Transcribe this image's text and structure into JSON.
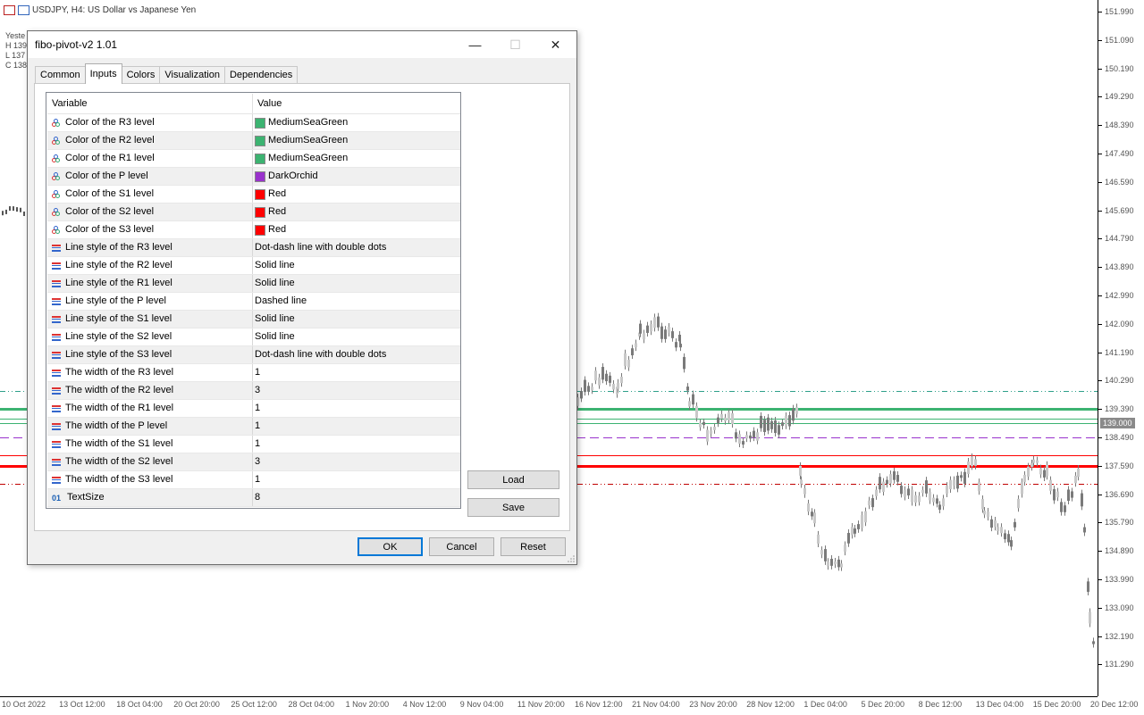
{
  "chart": {
    "symbol_line": "USDJPY, H4:  US Dollar vs Japanese Yen",
    "ohlc": [
      "Yeste",
      "H 139",
      "L 137",
      "C 138"
    ],
    "price_labels": [
      "151.990",
      "151.090",
      "150.190",
      "149.290",
      "148.390",
      "147.490",
      "146.590",
      "145.690",
      "144.790",
      "143.890",
      "142.990",
      "142.090",
      "141.190",
      "140.290",
      "139.390",
      "138.490",
      "137.590",
      "136.690",
      "135.790",
      "134.890",
      "133.990",
      "133.090",
      "132.190",
      "131.290"
    ],
    "current_price": "139.000",
    "time_labels": [
      "10 Oct 2022",
      "13 Oct 12:00",
      "18 Oct 04:00",
      "20 Oct 20:00",
      "25 Oct 12:00",
      "28 Oct 04:00",
      "1 Nov 20:00",
      "4 Nov 12:00",
      "9 Nov 04:00",
      "11 Nov 20:00",
      "16 Nov 12:00",
      "21 Nov 04:00",
      "23 Nov 20:00",
      "28 Nov 12:00",
      "1 Dec 04:00",
      "5 Dec 20:00",
      "8 Dec 12:00",
      "13 Dec 04:00",
      "15 Dec 20:00",
      "20 Dec 12:00"
    ],
    "colors": {
      "r3": "#2fa08a",
      "r2": "#3cb371",
      "r1": "#3cb371",
      "p": "#9932cc",
      "s1": "#ff0000",
      "s2": "#ff0000",
      "s3": "#c00000",
      "candles": "#7a7a7a"
    }
  },
  "dialog": {
    "title": "fibo-pivot-v2 1.01",
    "minimize_glyph": "—",
    "maximize_glyph": "☐",
    "close_glyph": "✕",
    "tabs": [
      "Common",
      "Inputs",
      "Colors",
      "Visualization",
      "Dependencies"
    ],
    "active_tab": "Inputs",
    "grid": {
      "col_variable": "Variable",
      "col_value": "Value",
      "rows": [
        {
          "icon": "color",
          "variable": "Color of the R3 level",
          "value": "MediumSeaGreen",
          "swatch": "#3cb371"
        },
        {
          "icon": "color",
          "variable": "Color of the R2 level",
          "value": "MediumSeaGreen",
          "swatch": "#3cb371"
        },
        {
          "icon": "color",
          "variable": "Color of the R1 level",
          "value": "MediumSeaGreen",
          "swatch": "#3cb371"
        },
        {
          "icon": "color",
          "variable": "Color of the P level",
          "value": "DarkOrchid",
          "swatch": "#9932cc"
        },
        {
          "icon": "color",
          "variable": "Color of the S1 level",
          "value": "Red",
          "swatch": "#ff0000"
        },
        {
          "icon": "color",
          "variable": "Color of the S2 level",
          "value": "Red",
          "swatch": "#ff0000"
        },
        {
          "icon": "color",
          "variable": "Color of the S3 level",
          "value": "Red",
          "swatch": "#ff0000"
        },
        {
          "icon": "lines",
          "variable": "Line style of the R3 level",
          "value": "Dot-dash line with double dots"
        },
        {
          "icon": "lines",
          "variable": "Line style of the R2 level",
          "value": "Solid line"
        },
        {
          "icon": "lines",
          "variable": "Line style of the R1 level",
          "value": "Solid line"
        },
        {
          "icon": "lines",
          "variable": "Line style of the P level",
          "value": "Dashed line"
        },
        {
          "icon": "lines",
          "variable": "Line style of the S1 level",
          "value": "Solid line"
        },
        {
          "icon": "lines",
          "variable": "Line style of the S2 level",
          "value": "Solid line"
        },
        {
          "icon": "lines",
          "variable": "Line style of the S3 level",
          "value": "Dot-dash line with double dots"
        },
        {
          "icon": "lines",
          "variable": "The width of the R3 level",
          "value": "1"
        },
        {
          "icon": "lines",
          "variable": "The width of the R2 level",
          "value": "3"
        },
        {
          "icon": "lines",
          "variable": "The width of the R1 level",
          "value": "1"
        },
        {
          "icon": "lines",
          "variable": "The width of the P level",
          "value": "1"
        },
        {
          "icon": "lines",
          "variable": "The width of the S1 level",
          "value": "1"
        },
        {
          "icon": "lines",
          "variable": "The width of the S2 level",
          "value": "3"
        },
        {
          "icon": "lines",
          "variable": "The width of the S3 level",
          "value": "1"
        },
        {
          "icon": "int",
          "variable": "TextSize",
          "value": "8",
          "icon_text": "01"
        }
      ]
    },
    "load_label": "Load",
    "save_label": "Save",
    "ok_label": "OK",
    "cancel_label": "Cancel",
    "reset_label": "Reset"
  }
}
